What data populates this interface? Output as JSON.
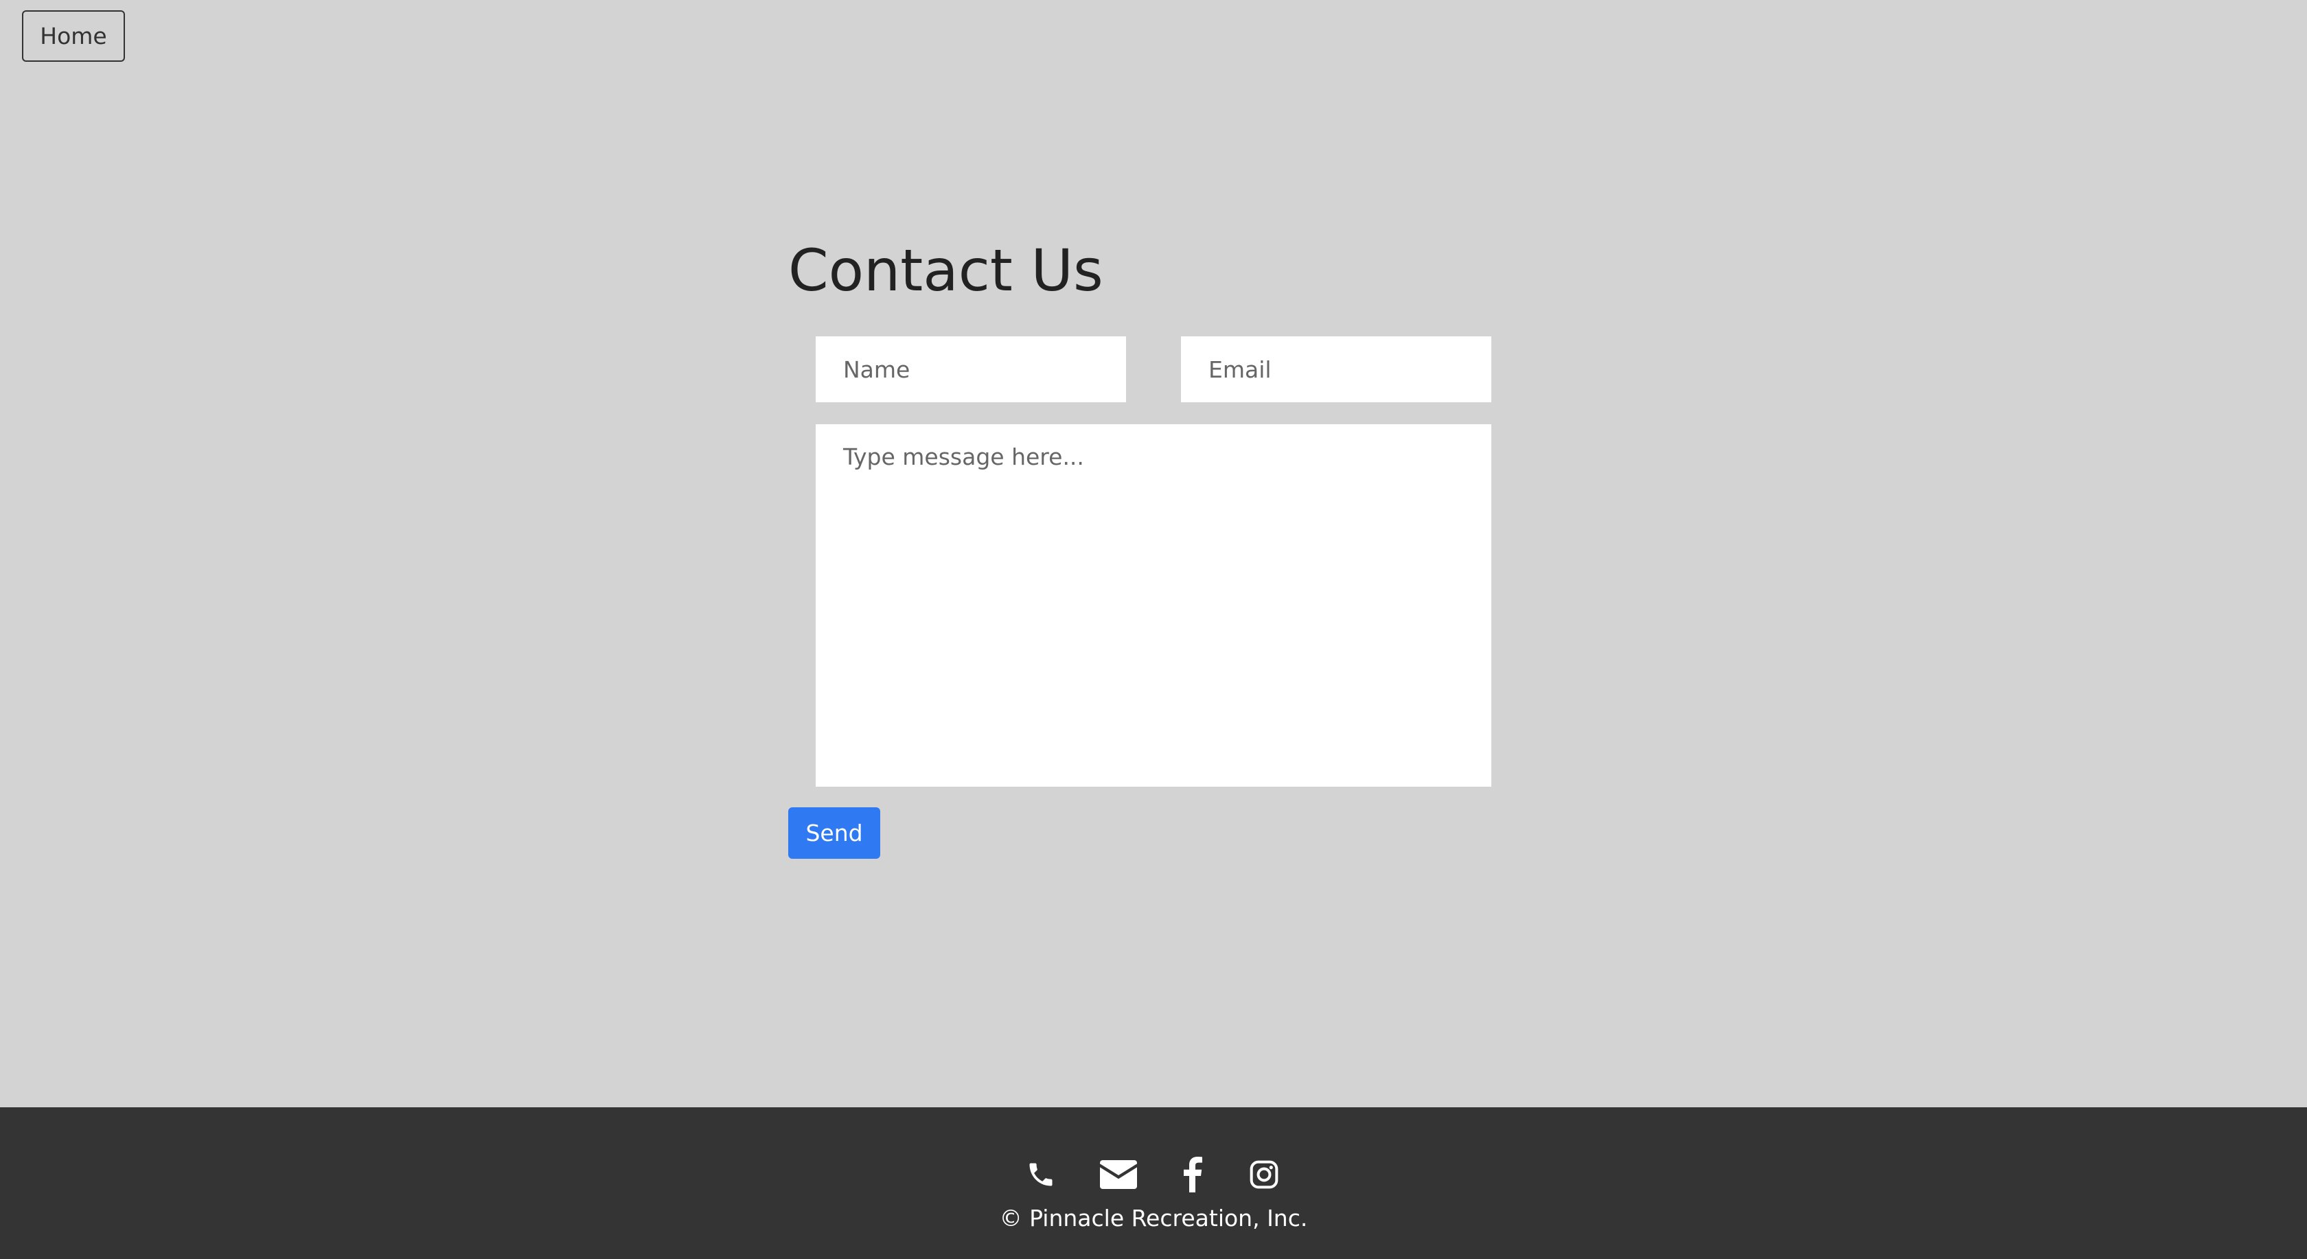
{
  "nav": {
    "home_label": "Home"
  },
  "page": {
    "title": "Contact Us"
  },
  "form": {
    "name_placeholder": "Name",
    "email_placeholder": "Email",
    "message_placeholder": "Type message here...",
    "send_label": "Send"
  },
  "footer": {
    "icons": [
      "phone-icon",
      "envelope-icon",
      "facebook-icon",
      "instagram-icon"
    ],
    "copyright": "© Pinnacle Recreation, Inc."
  },
  "colors": {
    "background": "#d3d3d4",
    "footer": "#343434",
    "accent": "#2f7af2"
  }
}
